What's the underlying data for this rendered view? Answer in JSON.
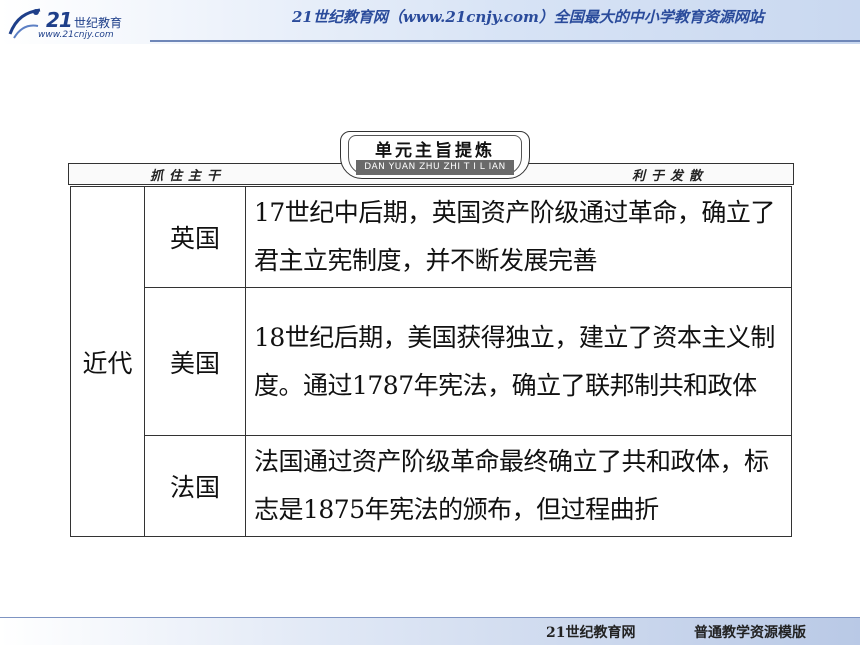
{
  "header": {
    "logo_number": "21",
    "logo_text": "世纪教育",
    "logo_url": "www.21cnjy.com",
    "site_text": "21世纪教育网（www.21cnjy.com）全国最大的中小学教育资源网站"
  },
  "banner": {
    "title": "单元主旨提炼",
    "subtitle": "DAN YUAN ZHU ZHI T I L IAN",
    "left_label": "抓住主干",
    "right_label": "利于发散"
  },
  "table": {
    "era": "近代",
    "rows": [
      {
        "country": "英国",
        "description": "17世纪中后期，英国资产阶级通过革命，确立了君主立宪制度，并不断发展完善"
      },
      {
        "country": "美国",
        "description": "18世纪后期，美国获得独立，建立了资本主义制度。通过1787年宪法，确立了联邦制共和政体"
      },
      {
        "country": "法国",
        "description": "法国通过资产阶级革命最终确立了共和政体，标志是1875年宪法的颁布，但过程曲折"
      }
    ]
  },
  "footer": {
    "left": "21世纪教育网",
    "right": "普通教学资源模版"
  },
  "colors": {
    "header_text": "#2a4b9b",
    "border": "#333333"
  }
}
